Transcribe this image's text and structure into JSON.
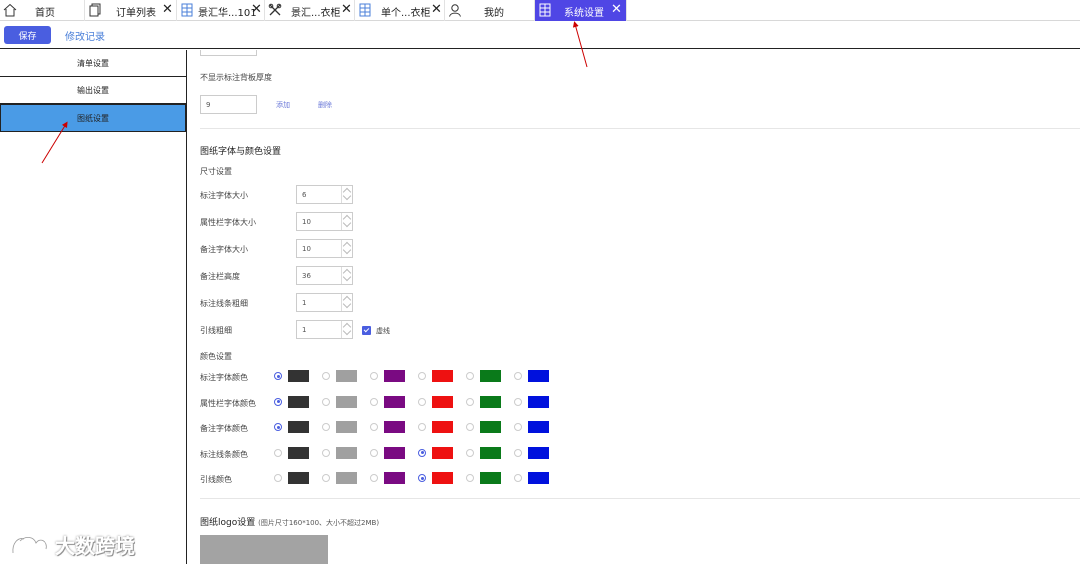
{
  "tabs": [
    {
      "label": "首页",
      "icon": "home-icon",
      "closable": false
    },
    {
      "label": "订单列表",
      "icon": "document-icon",
      "closable": true
    },
    {
      "label": "景汇华...101",
      "icon": "grid-icon",
      "closable": true
    },
    {
      "label": "景汇...衣柜",
      "icon": "tools-icon",
      "closable": true
    },
    {
      "label": "单个...衣柜",
      "icon": "grid-icon",
      "closable": true
    },
    {
      "label": "我的",
      "icon": "user-icon",
      "closable": false
    },
    {
      "label": "系统设置",
      "icon": "grid-icon",
      "closable": true,
      "active": true
    }
  ],
  "toolbar": {
    "save_label": "保存",
    "history_label": "修改记录"
  },
  "sidebar": {
    "items": [
      {
        "label": "清单设置"
      },
      {
        "label": "输出设置"
      },
      {
        "label": "图纸设置",
        "active": true
      }
    ]
  },
  "backboard": {
    "label": "不显示标注背板厚度",
    "value": "9",
    "add_label": "添加",
    "delete_label": "删除"
  },
  "font_color": {
    "title": "图纸字体与颜色设置",
    "size_title": "尺寸设置",
    "sizes": [
      {
        "label": "标注字体大小",
        "value": "6"
      },
      {
        "label": "属性栏字体大小",
        "value": "10"
      },
      {
        "label": "备注字体大小",
        "value": "10"
      },
      {
        "label": "备注栏高度",
        "value": "36"
      },
      {
        "label": "标注线条粗细",
        "value": "1"
      },
      {
        "label": "引线粗细",
        "value": "1"
      }
    ],
    "dashed_label": "虚线",
    "dashed_checked": true,
    "color_title": "颜色设置",
    "swatches": [
      "#333333",
      "#a0a0a0",
      "#7a0a82",
      "#ee1111",
      "#0a7a1a",
      "#0011dd"
    ],
    "colors": [
      {
        "label": "标注字体颜色",
        "selected": 0
      },
      {
        "label": "属性栏字体颜色",
        "selected": 0
      },
      {
        "label": "备注字体颜色",
        "selected": 0
      },
      {
        "label": "标注线条颜色",
        "selected": 3
      },
      {
        "label": "引线颜色",
        "selected": 3
      }
    ]
  },
  "logo": {
    "title": "图纸logo设置",
    "hint": "(图片尺寸160*100、大小不超过2MB)"
  },
  "watermark": {
    "text": "大数跨境"
  }
}
